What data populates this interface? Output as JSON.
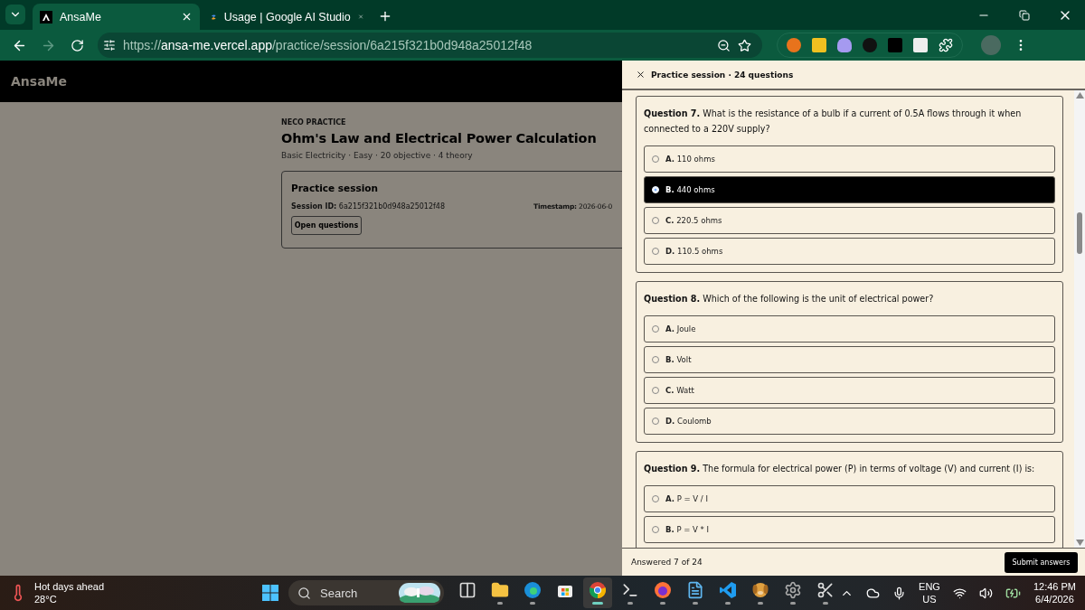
{
  "browser": {
    "tabs": [
      {
        "title": "AnsaMe",
        "selected": true
      },
      {
        "title": "Usage | Google AI Studio",
        "selected": false
      }
    ],
    "nav_buttons": [
      {
        "kind": "back",
        "disabled": false
      },
      {
        "kind": "forward",
        "disabled": true
      },
      {
        "kind": "reload",
        "disabled": false
      }
    ],
    "url": {
      "scheme": "https://",
      "host": "ansa-me.vercel.app",
      "path": "/practice/session/6a215f321b0d948a25012f48"
    }
  },
  "site": {
    "logo": "AnsaMe",
    "eyebrow": "NECO PRACTICE",
    "title": "Ohm's Law and Electrical Power Calculation",
    "meta": "Basic Electricity · Easy · 20 objective · 4 theory",
    "session_card": {
      "title": "Practice session",
      "session_id": "**Session ID:** 6a215f321b0d948a25012f48",
      "timestamp": "**Timestamp:** 2026-06-0",
      "button": "Open questions"
    }
  },
  "drawer": {
    "title": "Practice session · 24 questions",
    "questions": [
      {
        "text": "**Question 7.** What is the resistance of a bulb if a current of 0.5A flows through it when connected to a 220V supply?",
        "options": [
          {
            "text": "**A.** 110 ohms",
            "selected": false
          },
          {
            "text": "**B.** 440 ohms",
            "selected": true
          },
          {
            "text": "**C.** 220.5 ohms",
            "selected": false
          },
          {
            "text": "**D.** 110.5 ohms",
            "selected": false
          }
        ]
      },
      {
        "text": "**Question 8.** Which of the following is the unit of electrical power?",
        "options": [
          {
            "text": "**A.** Joule",
            "selected": false
          },
          {
            "text": "**B.** Volt",
            "selected": false
          },
          {
            "text": "**C.** Watt",
            "selected": false
          },
          {
            "text": "**D.** Coulomb",
            "selected": false
          }
        ]
      },
      {
        "text": "**Question 9.** The formula for electrical power (P) in terms of voltage (V) and current (I) is:",
        "options": [
          {
            "text": "**A.** P = V / I",
            "selected": false
          },
          {
            "text": "**B.** P = V * I",
            "selected": false
          }
        ]
      }
    ],
    "progress": "Answered 7 of 24",
    "submit": "Submit answers"
  },
  "taskbar": {
    "weather": {
      "title": "Hot days ahead",
      "temp": "28°C"
    },
    "search": "Search",
    "apps": [
      {
        "kind": "taskview",
        "running": false,
        "selected": false
      },
      {
        "kind": "explorer",
        "running": true,
        "selected": false
      },
      {
        "kind": "edge",
        "running": true,
        "selected": false
      },
      {
        "kind": "store",
        "running": false,
        "selected": false
      },
      {
        "kind": "chrome",
        "running": true,
        "selected": true
      },
      {
        "kind": "terminal",
        "running": true,
        "selected": false
      },
      {
        "kind": "firefox",
        "running": true,
        "selected": false
      },
      {
        "kind": "notepad",
        "running": true,
        "selected": false
      },
      {
        "kind": "vscode",
        "running": true,
        "selected": false
      },
      {
        "kind": "dog",
        "running": true,
        "selected": false
      },
      {
        "kind": "settings",
        "running": true,
        "selected": false
      },
      {
        "kind": "snip",
        "running": true,
        "selected": false
      }
    ],
    "language": "ENG",
    "region": "US",
    "time": "12:46 PM",
    "date": "6/4/2026"
  }
}
